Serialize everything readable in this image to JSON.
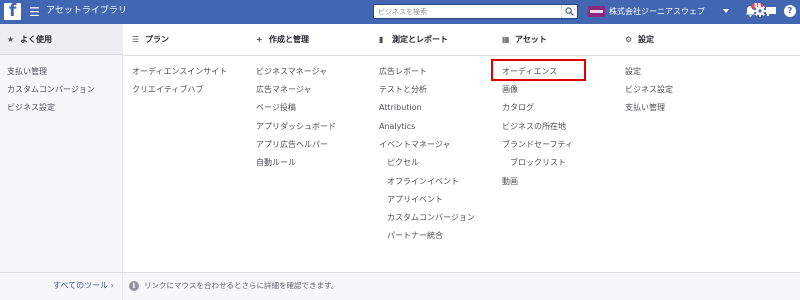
{
  "topbar": {
    "logo_letter": "f",
    "menu_glyph": "☰",
    "title": "アセットライブラリ",
    "search_placeholder": "ビジネスを検索",
    "business_name": "株式会社ジーニアスウェブ",
    "notification_count": "88",
    "help_glyph": "?"
  },
  "columns": {
    "frequent": {
      "title": "よく使用",
      "icon": "★",
      "items": [
        "支払い管理",
        "カスタムコンバージョン",
        "ビジネス設定"
      ]
    },
    "plan": {
      "title": "プラン",
      "icon": "☰",
      "items": [
        "オーディエンスインサイト",
        "クリエイティブハブ"
      ]
    },
    "create": {
      "title": "作成と管理",
      "icon": "+",
      "items": [
        "ビジネスマネージャ",
        "広告マネージャ",
        "ページ投稿",
        "アプリダッシュボード",
        "アプリ広告ヘルパー",
        "自動ルール"
      ]
    },
    "measure": {
      "title": "測定とレポート",
      "icon": "▮",
      "items": [
        "広告レポート",
        "テストと分析",
        "Attribution",
        "Analytics",
        "イベントマネージャ",
        "ピクセル",
        "オフラインイベント",
        "アプリイベント",
        "カスタムコンバージョン",
        "パートナー統合"
      ]
    },
    "assets": {
      "title": "アセット",
      "icon": "▦",
      "items": [
        "オーディエンス",
        "画像",
        "カタログ",
        "ビジネスの所在地",
        "ブランドセーフティ",
        "ブロックリスト",
        "動画"
      ]
    },
    "settings": {
      "title": "設定",
      "icon": "⚙",
      "items": [
        "設定",
        "ビジネス設定",
        "支払い管理"
      ]
    }
  },
  "footer": {
    "all_tools": "すべてのツール ›",
    "info_glyph": "i",
    "hint": "リンクにマウスを合わせるとさらに詳細を確認できます。"
  },
  "colors": {
    "topbar": "#4267b2",
    "highlight": "#e00000",
    "link": "#365899"
  },
  "icons": {
    "logo": "facebook-logo-icon",
    "menu": "hamburger-icon",
    "search": "search-icon",
    "notifications": "bell-icon",
    "flag": "flag-icon",
    "settings": "gear-icon",
    "help": "help-icon",
    "info": "info-icon"
  }
}
